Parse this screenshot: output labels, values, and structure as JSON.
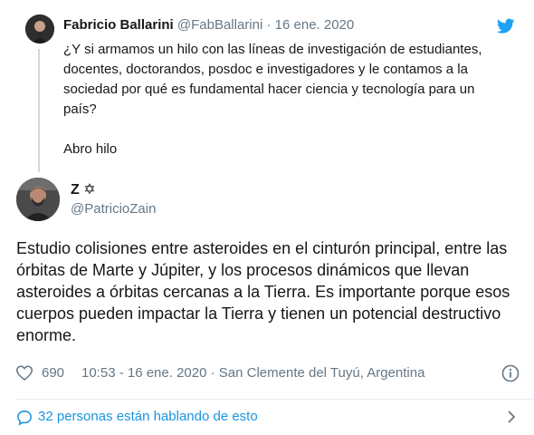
{
  "parent_tweet": {
    "author_name": "Fabricio Ballarini",
    "handle": "@FabBallarini",
    "separator": "·",
    "date": "16 ene. 2020",
    "text_lines": [
      "¿Y si armamos un hilo con las líneas de investigación de estudiantes, docentes, doctorandos, posdoc e investigadores y le contamos a la sociedad por qué es fundamental hacer ciencia y tecnología para un país?",
      "Abro hilo"
    ],
    "logo_icon": "twitter-bird-icon"
  },
  "tweet": {
    "author_name": "Z ✡",
    "handle": "@PatricioZain",
    "text": "Estudio colisiones entre asteroides en el cinturón principal, entre las órbitas de Marte y Júpiter, y los procesos dinámicos que llevan asteroides a órbitas cercanas a la Tierra. Es importante porque esos cuerpos pueden impactar la Tierra y tienen un potencial destructivo enorme.",
    "like_count": "690",
    "timestamp": "10:53 - 16 ene. 2020 · San Clemente del Tuyú, Argentina",
    "like_icon": "heart-icon",
    "info_icon": "info-icon"
  },
  "conversation": {
    "label": "32 personas están hablando de esto",
    "icon": "speech-bubble-icon",
    "chevron_icon": "chevron-right-icon"
  },
  "colors": {
    "accent": "#1b95e0",
    "text": "#14171a",
    "muted": "#657786",
    "divider": "#e6ecf0",
    "bird": "#1da1f2"
  }
}
